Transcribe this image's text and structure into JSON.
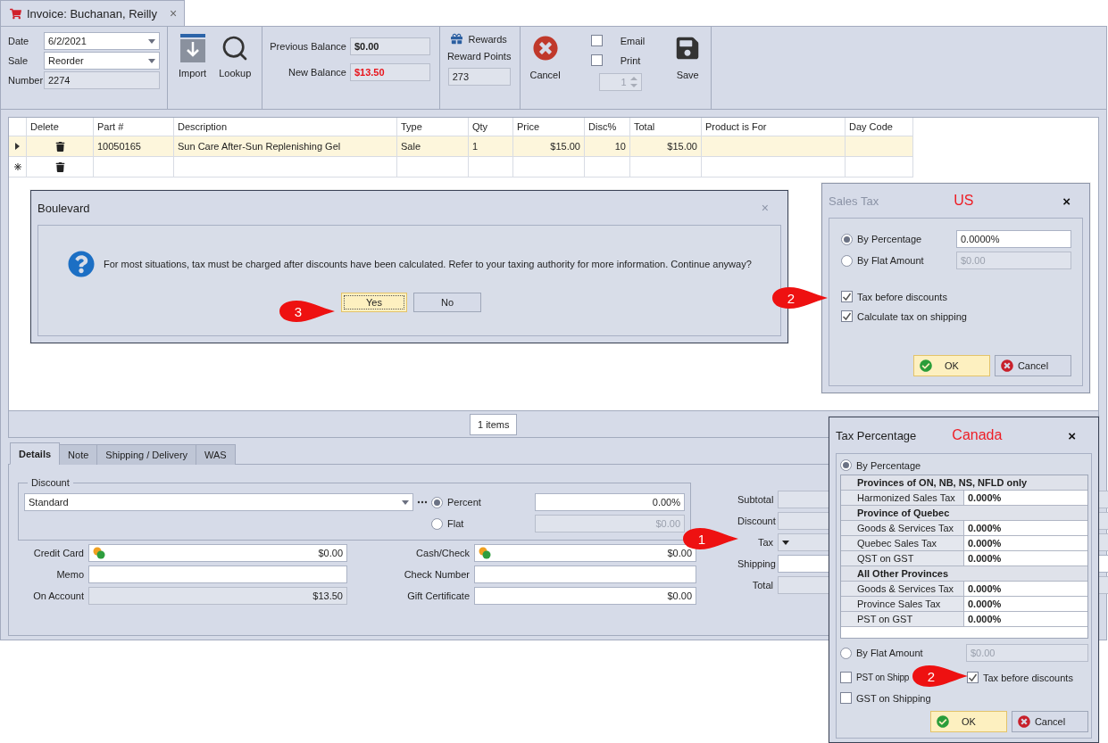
{
  "tab": {
    "title": "Invoice: Buchanan, Reilly",
    "close": "×"
  },
  "toolbar": {
    "date": {
      "label": "Date",
      "value": "6/2/2021"
    },
    "sale": {
      "label": "Sale",
      "value": "Reorder"
    },
    "number": {
      "label": "Number",
      "value": "2274"
    },
    "actions": [
      {
        "label": "Import",
        "kind": "import"
      },
      {
        "label": "Lookup",
        "kind": "lookup"
      }
    ],
    "previous_balance": {
      "label": "Previous Balance",
      "value": "$0.00"
    },
    "new_balance": {
      "label": "New Balance",
      "value": "$13.50"
    },
    "rewards": {
      "label": "Rewards"
    },
    "reward_points": {
      "label": "Reward Points",
      "value": "273"
    },
    "cancel": {
      "label": "Cancel"
    },
    "email": {
      "label": "Email",
      "checked": false
    },
    "print": {
      "label": "Print",
      "checked": false
    },
    "copies": {
      "value": "1"
    },
    "save": {
      "label": "Save"
    }
  },
  "grid": {
    "columns": [
      "Delete",
      "Part #",
      "Description",
      "Type",
      "Qty",
      "Price",
      "Disc%",
      "Total",
      "Product is For",
      "Day Code"
    ],
    "rows": [
      {
        "kind": "current",
        "selected": true,
        "cells": [
          "",
          "10050165",
          "Sun Care After-Sun Replenishing Gel",
          "Sale",
          "1",
          "$15.00",
          "10",
          "$15.00"
        ]
      },
      {
        "kind": "new",
        "selected": false,
        "cells": []
      }
    ],
    "footer": "1 items"
  },
  "detail_tabs": [
    {
      "label": "Details",
      "selected": true
    },
    {
      "label": "Note",
      "selected": false
    },
    {
      "label": "Shipping / Delivery",
      "selected": false
    },
    {
      "label": "WAS",
      "selected": false
    }
  ],
  "discount": {
    "legend": "Discount",
    "value": "Standard",
    "options": [
      {
        "label": "Percent",
        "selected": true,
        "value": "0.00%"
      },
      {
        "label": "Flat",
        "selected": false,
        "value": "$0.00"
      }
    ]
  },
  "payments": [
    {
      "label": "Credit Card",
      "kind": "money",
      "value": "$0.00",
      "disabled": false
    },
    {
      "label": "Cash/Check",
      "kind": "money",
      "value": "$0.00",
      "disabled": false
    },
    {
      "label": "Memo",
      "kind": "text",
      "disabled": false
    },
    {
      "label": "Check Number",
      "kind": "text",
      "disabled": false
    },
    {
      "label": "On Account",
      "kind": "text",
      "value": "$13.50",
      "disabled": true
    },
    {
      "label": "Gift Certificate",
      "kind": "text",
      "value": "$0.00",
      "disabled": false
    }
  ],
  "totals": [
    {
      "label": "Subtotal",
      "kind": "text",
      "disabled": true
    },
    {
      "label": "Discount",
      "kind": "text",
      "disabled": true
    },
    {
      "label": "Tax",
      "kind": "dropdown",
      "disabled": true
    },
    {
      "label": "Shipping",
      "kind": "text",
      "disabled": false
    },
    {
      "label": "Total",
      "kind": "text",
      "disabled": true
    }
  ],
  "confirm_dialog": {
    "title": "Boulevard",
    "close": "×",
    "message": "For most situations, tax must be charged after discounts have been calculated. Refer to your taxing authority for more information. Continue anyway?",
    "buttons": [
      {
        "label": "Yes",
        "selected": true
      },
      {
        "label": "No",
        "selected": false
      }
    ]
  },
  "sales_tax_us": {
    "title": "Sales Tax",
    "region": "US",
    "close": "×",
    "options": [
      {
        "label": "By Percentage",
        "selected": true,
        "value": "0.0000%"
      },
      {
        "label": "By Flat Amount",
        "selected": false,
        "value": "$0.00"
      }
    ],
    "checks": [
      {
        "label": "Tax before discounts",
        "checked": true
      },
      {
        "label": "Calculate tax on shipping",
        "checked": true
      }
    ],
    "buttons": [
      {
        "label": "OK",
        "kind": "ok"
      },
      {
        "label": "Cancel",
        "kind": "cancel"
      }
    ]
  },
  "tax_percentage_canada": {
    "title": "Tax Percentage",
    "region": "Canada",
    "close": "×",
    "percentage_option": {
      "label": "By Percentage",
      "selected": true
    },
    "groups": [
      {
        "heading": "Provinces of ON, NB, NS, NFLD only",
        "rows": [
          {
            "label": "Harmonized Sales Tax",
            "value": "0.000%"
          }
        ]
      },
      {
        "heading": "Province of Quebec",
        "rows": [
          {
            "label": "Goods & Services Tax",
            "value": "0.000%"
          },
          {
            "label": "Quebec Sales Tax",
            "value": "0.000%"
          },
          {
            "label": "QST on GST",
            "value": "0.000%"
          }
        ]
      },
      {
        "heading": "All Other Provinces",
        "rows": [
          {
            "label": "Goods & Services Tax",
            "value": "0.000%"
          },
          {
            "label": "Province Sales Tax",
            "value": "0.000%"
          },
          {
            "label": "PST on GST",
            "value": "0.000%"
          }
        ]
      }
    ],
    "flat_option": {
      "label": "By Flat Amount",
      "selected": false,
      "value": "$0.00"
    },
    "checks": [
      {
        "label": "PST on Shipp",
        "checked": false
      },
      {
        "label": "Tax before discounts",
        "checked": true
      },
      {
        "label": "GST on Shipping",
        "checked": false
      }
    ],
    "buttons": [
      {
        "label": "OK",
        "kind": "ok"
      },
      {
        "label": "Cancel",
        "kind": "cancel"
      }
    ]
  },
  "callouts": [
    {
      "label": "3"
    },
    {
      "label": "2"
    },
    {
      "label": "1"
    },
    {
      "label": "2"
    }
  ]
}
